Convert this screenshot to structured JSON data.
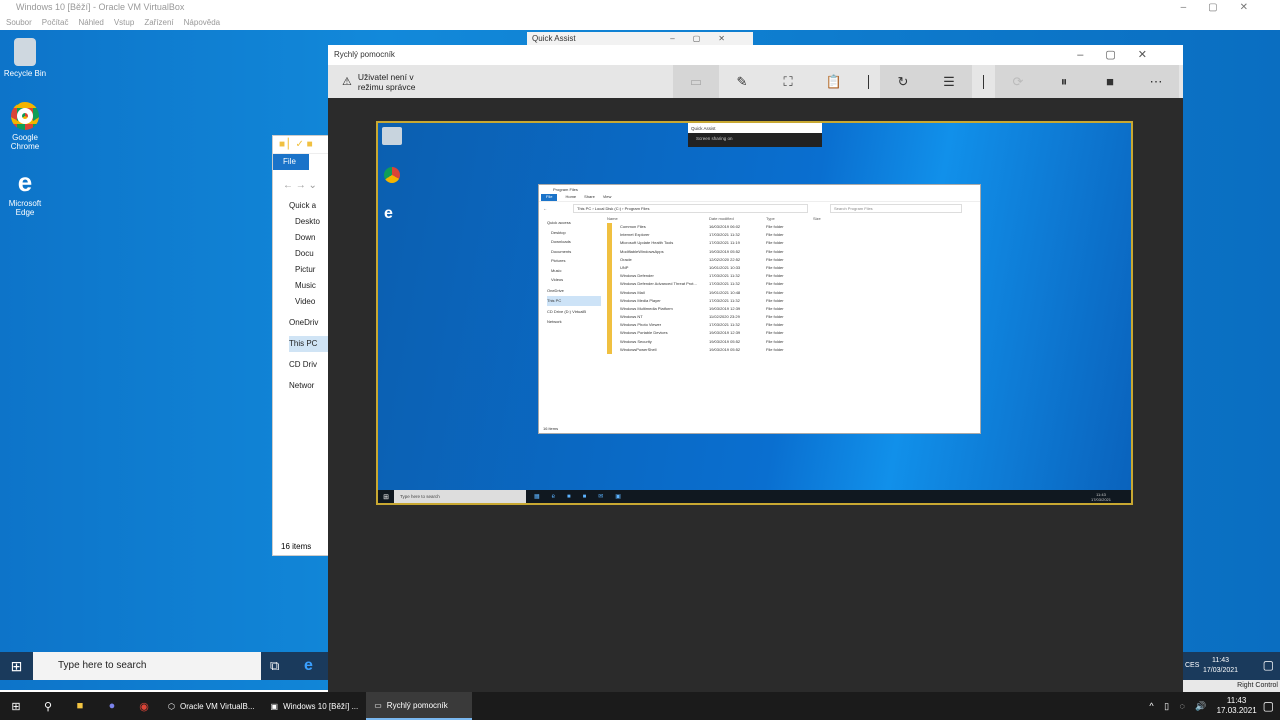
{
  "vbox": {
    "title": "Windows 10 [Běží] - Oracle VM VirtualBox",
    "menu": [
      "Soubor",
      "Počítač",
      "Náhled",
      "Vstup",
      "Zařízení",
      "Nápověda"
    ]
  },
  "desktop": {
    "icons": [
      "Recycle Bin",
      "Google Chrome",
      "Microsoft Edge"
    ]
  },
  "explorer": {
    "tab": "File",
    "nav": [
      "Quick a",
      "Deskto",
      "Down",
      "Docu",
      "Pictur",
      "Music",
      "Video",
      "OneDriv",
      "This PC",
      "CD Driv",
      "Networ"
    ],
    "status": "16 items"
  },
  "quickassist_small": {
    "title": "Quick Assist"
  },
  "quickassist": {
    "title": "Rychlý pomocník",
    "warning": "Uživatel není v režimu správce"
  },
  "remote": {
    "qa_title": "Quick Assist",
    "qa_status": "Screen sharing on",
    "path": [
      "This PC",
      "Local Disk (C:)",
      "Program Files"
    ],
    "search": "Search Program Files",
    "title": "Program Files",
    "columns": [
      "Name",
      "Date modified",
      "Type",
      "Size"
    ],
    "files": [
      [
        "Common Files",
        "16/03/2019 06:02",
        "File folder"
      ],
      [
        "Internet Explorer",
        "17/03/2021 11:32",
        "File folder"
      ],
      [
        "Microsoft Update Health Tools",
        "17/03/2021 11:19",
        "File folder"
      ],
      [
        "ModifiableWindowsApps",
        "19/03/2019 05:52",
        "File folder"
      ],
      [
        "Oracle",
        "12/02/2020 22:52",
        "File folder"
      ],
      [
        "UNP",
        "10/01/2021 10:33",
        "File folder"
      ],
      [
        "Windows Defender",
        "17/03/2021 11:32",
        "File folder"
      ],
      [
        "Windows Defender Advanced Threat Prot...",
        "17/03/2021 11:32",
        "File folder"
      ],
      [
        "Windows Mail",
        "19/01/2021 10:48",
        "File folder"
      ],
      [
        "Windows Media Player",
        "17/03/2021 11:32",
        "File folder"
      ],
      [
        "Windows Multimedia Platform",
        "19/03/2019 12:39",
        "File folder"
      ],
      [
        "Windows NT",
        "11/02/2020 23:29",
        "File folder"
      ],
      [
        "Windows Photo Viewer",
        "17/03/2021 11:32",
        "File folder"
      ],
      [
        "Windows Portable Devices",
        "19/03/2019 12:39",
        "File folder"
      ],
      [
        "Windows Security",
        "19/03/2019 05:52",
        "File folder"
      ],
      [
        "WindowsPowerShell",
        "19/03/2019 05:52",
        "File folder"
      ]
    ],
    "sidebar": [
      "Quick access",
      "Desktop",
      "Downloads",
      "Documents",
      "Pictures",
      "Music",
      "Videos",
      "OneDrive",
      "This PC",
      "CD Drive (D:) VirtualB",
      "Network"
    ],
    "status": "16 items",
    "search_box": "Type here to search",
    "clock": [
      "11:43",
      "17/03/2021"
    ]
  },
  "guest_taskbar": {
    "search": "Type here to search",
    "lang": "CES",
    "clock": [
      "11:43",
      "17/03/2021"
    ]
  },
  "right_control": "Right Control",
  "host_taskbar": {
    "apps": [
      "Oracle VM VirtualB...",
      "Windows 10 [Běží] ...",
      "Rychlý pomocník"
    ],
    "clock": [
      "11:43",
      "17.03.2021"
    ]
  }
}
